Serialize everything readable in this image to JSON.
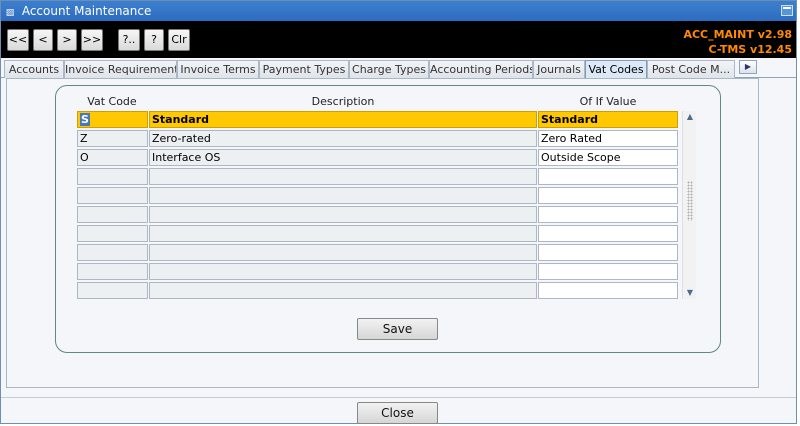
{
  "window": {
    "title": "Account Maintenance"
  },
  "toolbar": {
    "first": "<<",
    "prev": "<",
    "next": ">",
    "last": ">>",
    "query": "?..",
    "help": "?",
    "clear": "Clr",
    "version_line1": "ACC_MAINT v2.98",
    "version_line2": "C-TMS v12.45"
  },
  "tabs": [
    {
      "label": "Accounts",
      "active": false
    },
    {
      "label": "Invoice Requirements",
      "active": false
    },
    {
      "label": "Invoice Terms",
      "active": false
    },
    {
      "label": "Payment Types",
      "active": false
    },
    {
      "label": "Charge Types",
      "active": false
    },
    {
      "label": "Accounting Periods",
      "active": false
    },
    {
      "label": "Journals",
      "active": false
    },
    {
      "label": "Vat Codes",
      "active": true
    },
    {
      "label": "Post Code M...",
      "active": false
    }
  ],
  "table": {
    "headers": {
      "code": "Vat Code",
      "description": "Description",
      "of_if_value": "Of If Value"
    },
    "rows": [
      {
        "code": "S",
        "description": "Standard",
        "of_if_value": "Standard",
        "selected": true
      },
      {
        "code": "Z",
        "description": "Zero-rated",
        "of_if_value": "Zero Rated",
        "selected": false
      },
      {
        "code": "O",
        "description": "Interface OS",
        "of_if_value": "Outside Scope",
        "selected": false
      }
    ],
    "empty_rows": 7
  },
  "buttons": {
    "save": "Save",
    "close": "Close"
  },
  "colors": {
    "title_bar": "#2d6cc0",
    "toolbar_bg": "#000000",
    "version_text": "#ff8a00",
    "selected_row": "#ffc800",
    "fieldset_border": "#5f8b7a"
  }
}
